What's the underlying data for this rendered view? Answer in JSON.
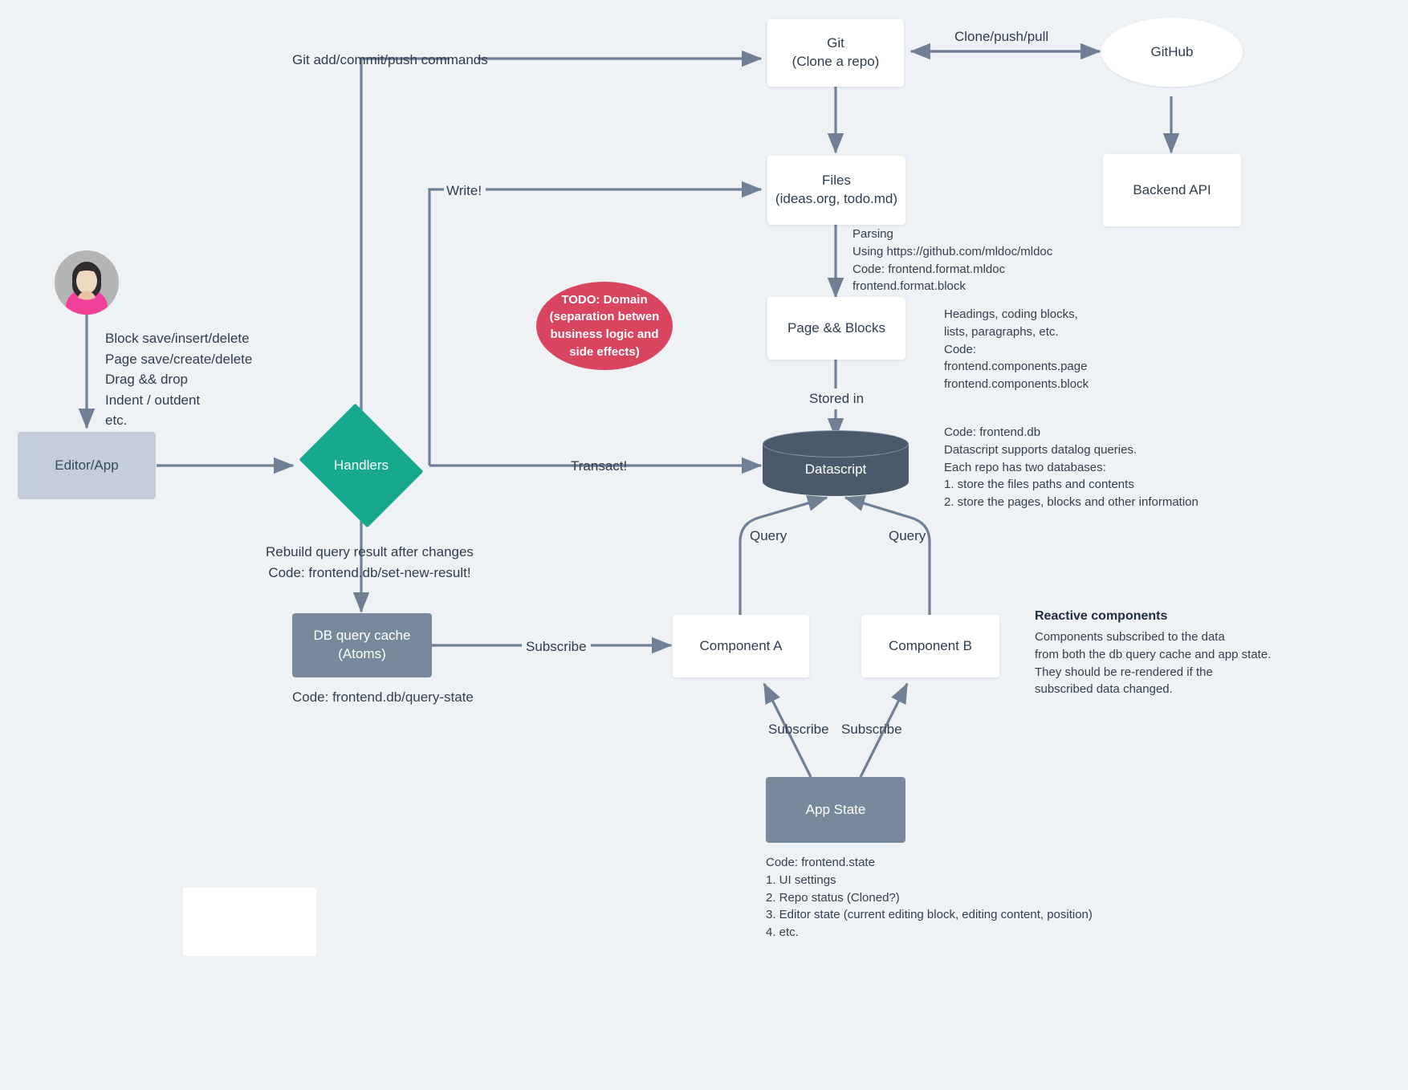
{
  "colors": {
    "background": "#eef2f5",
    "edge": "#6f8094",
    "handlers_accent": "#17a98c",
    "todo_accent": "#d9455f",
    "slate": "#79899c",
    "datascript": "#4a5a6b",
    "editor_app": "#c3ced8",
    "text": "#2e3d4e"
  },
  "nodes": {
    "git": {
      "line1": "Git",
      "line2": "(Clone a repo)"
    },
    "github": {
      "label": "GitHub"
    },
    "backend_api": {
      "label": "Backend API"
    },
    "files": {
      "line1": "Files",
      "line2": "(ideas.org, todo.md)"
    },
    "page_blocks": {
      "label": "Page && Blocks"
    },
    "datascript": {
      "label": "Datascript"
    },
    "editor_app": {
      "label": "Editor/App"
    },
    "handlers": {
      "label": "Handlers"
    },
    "db_query_cache": {
      "line1": "DB query cache",
      "line2": "(Atoms)"
    },
    "component_a": {
      "label": "Component A"
    },
    "component_b": {
      "label": "Component B"
    },
    "app_state": {
      "label": "App State"
    },
    "todo_bubble": {
      "text": "TODO: Domain\n(separation betwen\nbusiness logic and\nside effects)"
    }
  },
  "edge_labels": {
    "git_commands": "Git add/commit/push commands",
    "clone_push_pull": "Clone/push/pull",
    "write": "Write!",
    "transact": "Transact!",
    "stored_in": "Stored in",
    "query_left": "Query",
    "query_right": "Query",
    "subscribe_cache": "Subscribe",
    "subscribe_a": "Subscribe",
    "subscribe_b": "Subscribe"
  },
  "annotations": {
    "user_actions": "Block save/insert/delete\nPage save/create/delete\nDrag && drop\nIndent / outdent\netc.",
    "parsing": "Parsing\nUsing https://github.com/mldoc/mldoc\nCode: frontend.format.mldoc\n          frontend.format.block",
    "page_blocks_note": "Headings, coding blocks,\nlists, paragraphs, etc.\nCode:\nfrontend.components.page\nfrontend.components.block",
    "datascript_note": "Code: frontend.db\nDatascript supports datalog queries.\nEach repo has two databases:\n1. store the files paths and contents\n2. store the pages, blocks and other information",
    "rebuild_query": "Rebuild query result after changes\nCode: frontend.db/set-new-result!",
    "query_state_code": "Code: frontend.db/query-state",
    "reactive_title": "Reactive components",
    "reactive_body": "Components subscribed to the data\nfrom both the db query cache and app state.\nThey should be re-rendered if the\nsubscribed data changed.",
    "app_state_note": "Code: frontend.state\n1. UI settings\n2. Repo status (Cloned?)\n3. Editor state (current editing block, editing content, position)\n4. etc."
  }
}
